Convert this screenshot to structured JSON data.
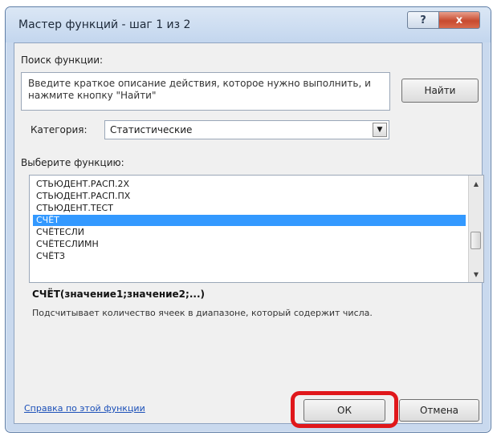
{
  "window": {
    "title": "Мастер функций - шаг 1 из 2",
    "help_icon": "?",
    "close_icon": "x"
  },
  "search": {
    "label": "Поиск функции:",
    "value": "Введите краткое описание действия, которое нужно выполнить, и нажмите кнопку \"Найти\"",
    "find_button": "Найти"
  },
  "category": {
    "label": "Категория:",
    "value": "Статистические"
  },
  "function_list": {
    "label": "Выберите функцию:",
    "items": [
      "СТЬЮДЕНТ.РАСП.2Х",
      "СТЬЮДЕНТ.РАСП.ПХ",
      "СТЬЮДЕНТ.ТЕСТ",
      "СЧЁТ",
      "СЧЁТЕСЛИ",
      "СЧЁТЕСЛИМН",
      "СЧЁТЗ"
    ],
    "selected_index": 3
  },
  "details": {
    "signature": "СЧЁТ(значение1;значение2;...)",
    "description": "Подсчитывает количество ячеек в диапазоне, который содержит числа."
  },
  "footer": {
    "help_link": "Справка по этой функции",
    "ok_button": "ОК",
    "cancel_button": "Отмена"
  },
  "colors": {
    "selection": "#3399ff",
    "highlight": "#e0171b"
  }
}
